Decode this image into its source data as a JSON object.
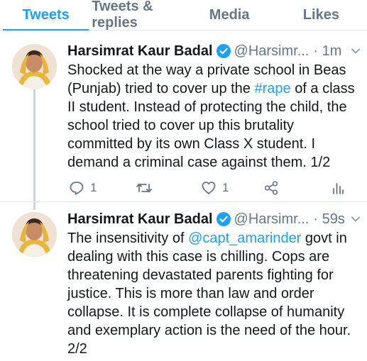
{
  "tabs": [
    "Tweets",
    "Tweets & replies",
    "Media",
    "Likes"
  ],
  "colors": {
    "accent": "#1da1f2",
    "secondary_text": "#657786",
    "divider": "#e1e8ed"
  },
  "tweets": [
    {
      "name": "Harsimrat Kaur Badal",
      "handle": "@Harsimr...",
      "time": "· 1m",
      "text_before": "Shocked at the way a private school in Beas (Punjab) tried to cover up the ",
      "link": "#rape",
      "text_after": " of a class II student. Instead of protecting the child, the school tried to cover up this brutality committed by its own Class X student. I demand a criminal case against them. 1/2",
      "reply_count": "1",
      "like_count": "1"
    },
    {
      "name": "Harsimrat Kaur Badal",
      "handle": "@Harsimr...",
      "time": "· 59s",
      "text_before": "The insensitivity of ",
      "link": "@capt_amarinder",
      "text_after": " govt in dealing with this case is chilling. Cops are threatening devastated parents fighting for justice. This is more than law and order collapse. It is complete collapse of humanity and exemplary action is the need of the hour. 2/2"
    }
  ],
  "icons": [
    "verified-badge-icon",
    "chevron-down-icon",
    "reply-icon",
    "retweet-icon",
    "like-icon",
    "share-icon",
    "analytics-icon"
  ]
}
